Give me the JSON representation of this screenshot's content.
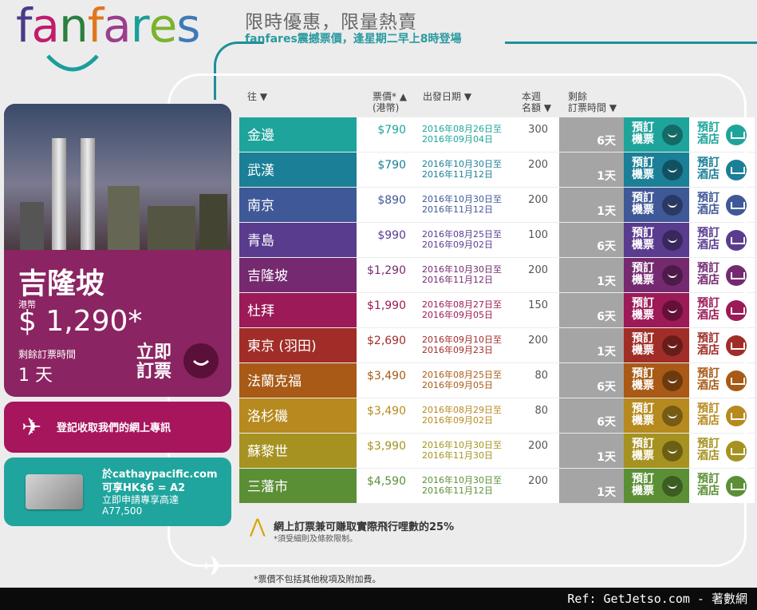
{
  "logo": {
    "letters": [
      "f",
      "a",
      "n",
      "f",
      "a",
      "r",
      "e",
      "s"
    ],
    "colors": [
      "#4b3a8c",
      "#c01c6d",
      "#2b7f3f",
      "#e0761e",
      "#9b3e8d",
      "#1a9e9a",
      "#7ab32e",
      "#3e7ab8"
    ]
  },
  "header": {
    "promo": "限時優惠，限量熱賣",
    "sub": "fanfares震撼票價，逢星期二早上8時登場"
  },
  "featured": {
    "city": "吉隆坡",
    "currency": "港幣",
    "price": "$ 1,290*",
    "remaining_label": "剩餘訂票時間",
    "remaining_value": "1 天",
    "book_label": "立即訂票"
  },
  "newsletter": {
    "label": "登記收取我們的網上專訊"
  },
  "amex": {
    "line1": "於cathaypacific.com",
    "line2": "可享HK$6 = A2",
    "line3": "立即申請專享高達",
    "line4": "A77,500"
  },
  "table_headers": {
    "dest": "往 ▼",
    "fare": "票價* ▲",
    "fare_sub": "(港幣)",
    "date": "出發日期 ▼",
    "quota": "本週",
    "quota_sub": "名額 ▼",
    "remaining": "剩餘",
    "remaining_sub": "訂票時間 ▼"
  },
  "rows": [
    {
      "dest": "金邊",
      "price": "$790",
      "date1": "2016年08月26日至",
      "date2": "2016年09月04日",
      "quota": "300",
      "remaining": "6天",
      "flight": "預訂機票",
      "hotel": "預訂酒店",
      "color": "#1fa49c"
    },
    {
      "dest": "武漢",
      "price": "$790",
      "date1": "2016年10月30日至",
      "date2": "2016年11月12日",
      "quota": "200",
      "remaining": "1天",
      "flight": "預訂機票",
      "hotel": "預訂酒店",
      "color": "#1a7f97"
    },
    {
      "dest": "南京",
      "price": "$890",
      "date1": "2016年10月30日至",
      "date2": "2016年11月12日",
      "quota": "200",
      "remaining": "1天",
      "flight": "預訂機票",
      "hotel": "預訂酒店",
      "color": "#3f5897"
    },
    {
      "dest": "青島",
      "price": "$990",
      "date1": "2016年08月25日至",
      "date2": "2016年09月02日",
      "quota": "100",
      "remaining": "6天",
      "flight": "預訂機票",
      "hotel": "預訂酒店",
      "color": "#5a3c8f"
    },
    {
      "dest": "吉隆坡",
      "price": "$1,290",
      "date1": "2016年10月30日至",
      "date2": "2016年11月12日",
      "quota": "200",
      "remaining": "1天",
      "flight": "預訂機票",
      "hotel": "預訂酒店",
      "color": "#752a70"
    },
    {
      "dest": "杜拜",
      "price": "$1,990",
      "date1": "2016年08月27日至",
      "date2": "2016年09月05日",
      "quota": "150",
      "remaining": "6天",
      "flight": "預訂機票",
      "hotel": "預訂酒店",
      "color": "#9b1a57"
    },
    {
      "dest": "東京 (羽田)",
      "price": "$2,690",
      "date1": "2016年09月10日至",
      "date2": "2016年09月23日",
      "quota": "200",
      "remaining": "1天",
      "flight": "預訂機票",
      "hotel": "預訂酒店",
      "color": "#a12d28"
    },
    {
      "dest": "法蘭克福",
      "price": "$3,490",
      "date1": "2016年08月25日至",
      "date2": "2016年09月05日",
      "quota": "80",
      "remaining": "6天",
      "flight": "預訂機票",
      "hotel": "預訂酒店",
      "color": "#a85a16"
    },
    {
      "dest": "洛杉磯",
      "price": "$3,490",
      "date1": "2016年08月29日至",
      "date2": "2016年09月02日",
      "quota": "80",
      "remaining": "6天",
      "flight": "預訂機票",
      "hotel": "預訂酒店",
      "color": "#b78a1f"
    },
    {
      "dest": "蘇黎世",
      "price": "$3,990",
      "date1": "2016年10月30日至",
      "date2": "2016年11月30日",
      "quota": "200",
      "remaining": "1天",
      "flight": "預訂機票",
      "hotel": "預訂酒店",
      "color": "#a59220"
    },
    {
      "dest": "三藩市",
      "price": "$4,590",
      "date1": "2016年10月30日至",
      "date2": "2016年11月12日",
      "quota": "200",
      "remaining": "1天",
      "flight": "預訂機票",
      "hotel": "預訂酒店",
      "color": "#5b8f35"
    }
  ],
  "miles": {
    "line1": "網上訂票兼可賺取實際飛行哩數的25%",
    "line2": "*須受細則及條款限制。"
  },
  "footnote": "*票價不包括其他稅項及附加費。",
  "ref": "Ref: GetJetso.com - 著數網"
}
